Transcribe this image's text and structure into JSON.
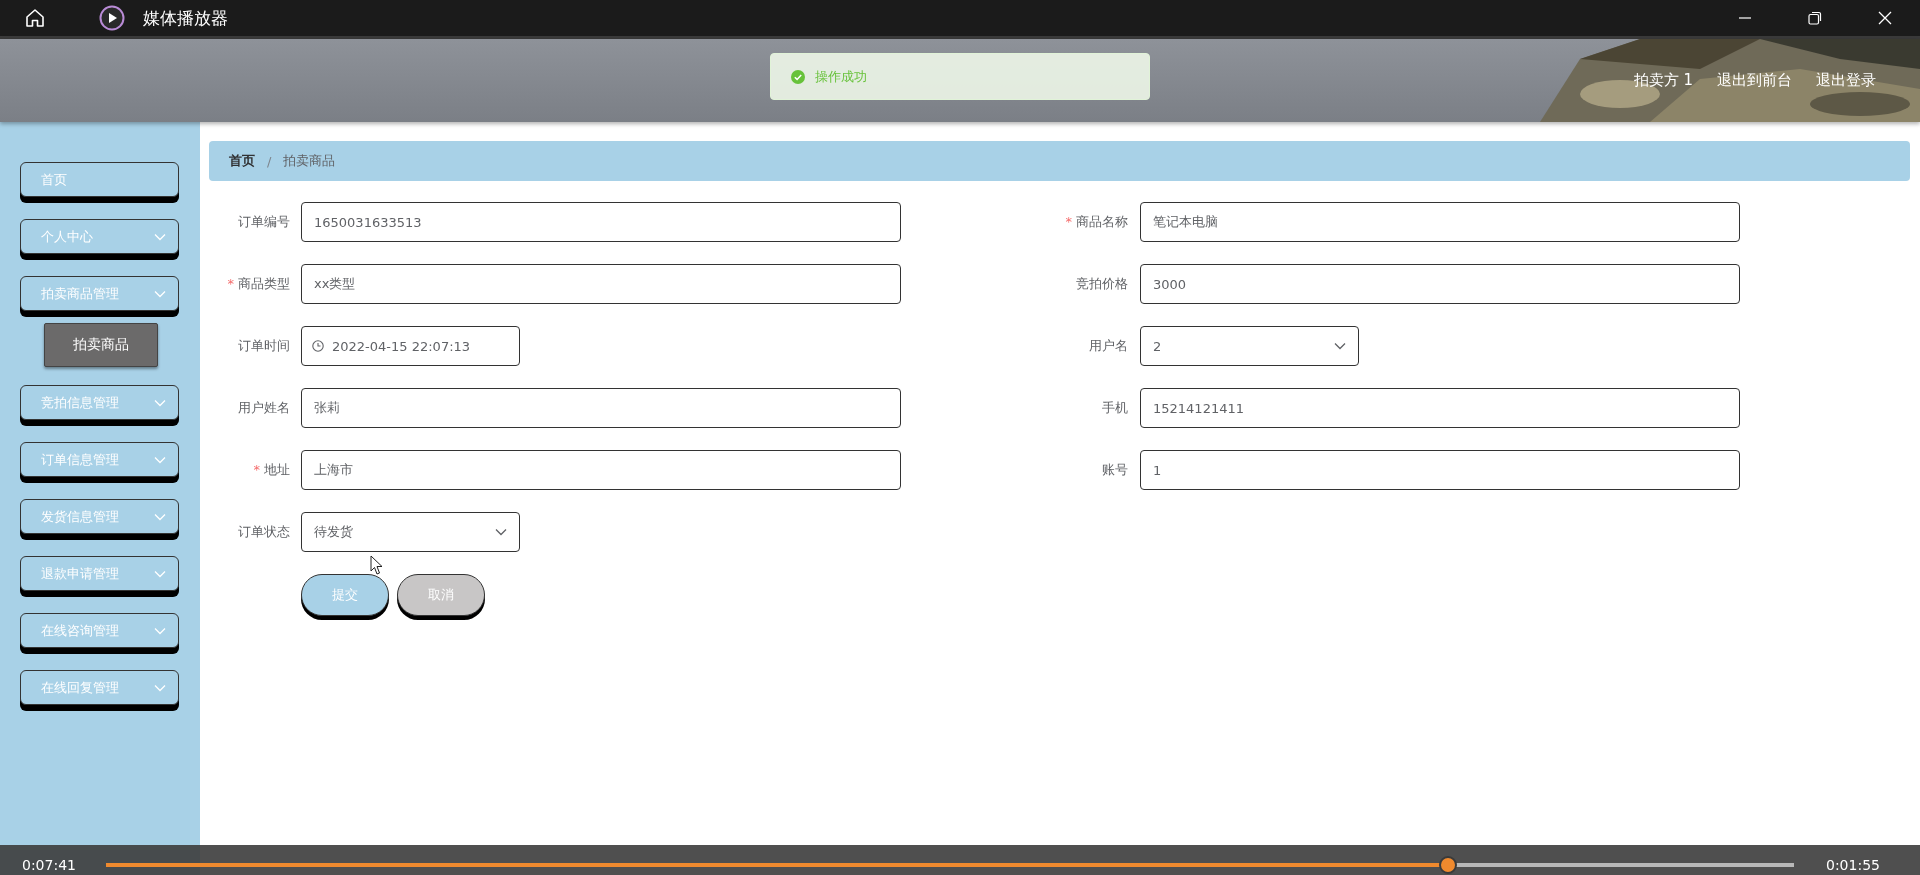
{
  "player": {
    "title": "媒体播放器",
    "elapsed": "0:07:41",
    "remaining": "0:01:55",
    "level": 0.795
  },
  "header": {
    "links": [
      "拍卖方 1",
      "退出到前台",
      "退出登录"
    ]
  },
  "toast": {
    "message": "操作成功"
  },
  "sidebar": {
    "items": [
      {
        "label": "首页",
        "kind": "link"
      },
      {
        "label": "个人中心",
        "kind": "menu"
      },
      {
        "label": "拍卖商品管理",
        "kind": "menu",
        "children": [
          {
            "label": "拍卖商品",
            "selected": true
          }
        ]
      },
      {
        "label": "竞拍信息管理",
        "kind": "menu"
      },
      {
        "label": "订单信息管理",
        "kind": "menu"
      },
      {
        "label": "发货信息管理",
        "kind": "menu"
      },
      {
        "label": "退款申请管理",
        "kind": "menu"
      },
      {
        "label": "在线咨询管理",
        "kind": "menu"
      },
      {
        "label": "在线回复管理",
        "kind": "menu"
      }
    ]
  },
  "breadcrumb": {
    "items": [
      "首页",
      "拍卖商品"
    ],
    "separator": "/"
  },
  "form": {
    "left_fields": [
      {
        "label": "订单编号",
        "value": "1650031633513",
        "kind": "text"
      },
      {
        "label": "商品类型",
        "value": "xx类型",
        "required_mark": "*",
        "kind": "text"
      },
      {
        "label": "订单时间",
        "value": "2022-04-15 22:07:13",
        "kind": "date"
      },
      {
        "label": "用户姓名",
        "value": "张莉",
        "kind": "text"
      },
      {
        "label": "地址",
        "value": "上海市",
        "required_mark": "*",
        "kind": "text"
      },
      {
        "label": "订单状态",
        "value": "待发货",
        "kind": "select"
      }
    ],
    "right_fields": [
      {
        "label": "商品名称",
        "value": "笔记本电脑",
        "required_mark": "*",
        "kind": "text"
      },
      {
        "label": "竞拍价格",
        "value": "3000",
        "kind": "text"
      },
      {
        "label": "用户名",
        "value": "2",
        "kind": "select"
      },
      {
        "label": "手机",
        "value": "15214121411",
        "kind": "text"
      },
      {
        "label": "账号",
        "value": "1",
        "kind": "text"
      }
    ],
    "buttons": [
      {
        "label": "提交",
        "kind": "primary"
      },
      {
        "label": "取消",
        "kind": "default"
      }
    ]
  }
}
